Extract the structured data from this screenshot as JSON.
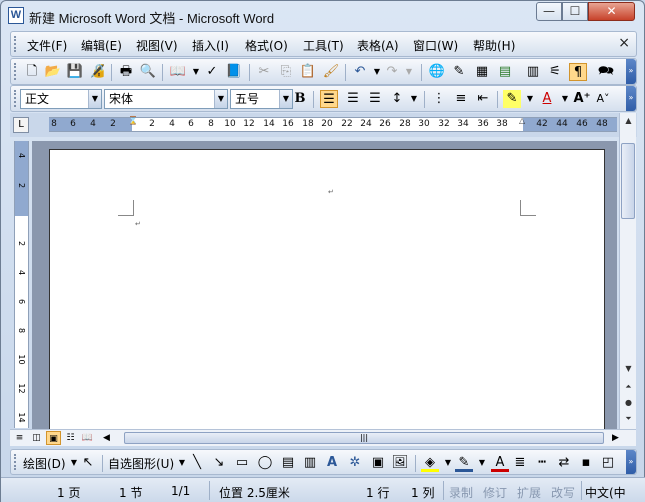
{
  "window": {
    "title": "新建 Microsoft Word 文档 - Microsoft Word",
    "app_icon": "W",
    "min": "—",
    "max": "☐",
    "close": "✕"
  },
  "menu": {
    "items": [
      "文件(F)",
      "编辑(E)",
      "视图(V)",
      "插入(I)",
      "格式(O)",
      "工具(T)",
      "表格(A)",
      "窗口(W)",
      "帮助(H)"
    ],
    "close": "×"
  },
  "format": {
    "style": "正文",
    "font": "宋体",
    "size": "五号",
    "bold": "B"
  },
  "ruler": {
    "ticks": [
      "8",
      "6",
      "4",
      "2",
      "2",
      "4",
      "6",
      "8",
      "10",
      "12",
      "14",
      "16",
      "18",
      "20",
      "22",
      "24",
      "26",
      "28",
      "30",
      "32",
      "34",
      "36",
      "38",
      "42",
      "44",
      "46",
      "48"
    ],
    "vticks": [
      "4",
      "2",
      "2",
      "4",
      "6",
      "8",
      "10",
      "12",
      "14"
    ]
  },
  "draw": {
    "draw_label": "绘图(D)",
    "autoshape_label": "自选图形(U)"
  },
  "status": {
    "page": "1 页",
    "section": "1 节",
    "pages": "1/1",
    "position": "位置 2.5厘米",
    "line": "1 行",
    "column": "1 列",
    "rec": "录制",
    "trk": "修订",
    "ext": "扩展",
    "ovr": "改写",
    "lang": "中文(中"
  },
  "colors": {
    "accent": "#2f5da8",
    "highlight": "#ffd88c",
    "page_bg": "#8a97ad"
  }
}
